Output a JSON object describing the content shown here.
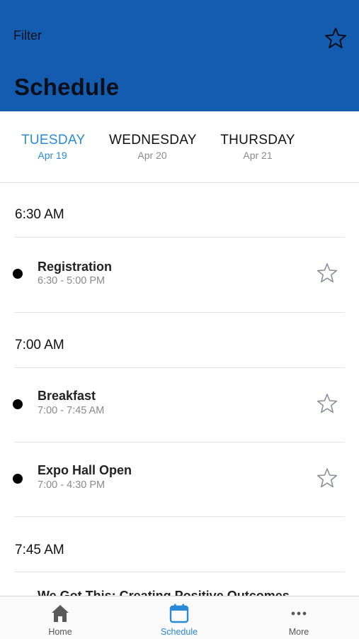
{
  "header": {
    "filter_label": "Filter",
    "title": "Schedule",
    "background_color": "#135cb0"
  },
  "days": [
    {
      "name": "TUESDAY",
      "date": "Apr 19",
      "active": true
    },
    {
      "name": "WEDNESDAY",
      "date": "Apr 20",
      "active": false
    },
    {
      "name": "THURSDAY",
      "date": "Apr 21",
      "active": false
    }
  ],
  "schedule": {
    "groups": [
      {
        "time": "6:30 AM",
        "events": [
          {
            "title": "Registration",
            "time": "6:30 - 5:00 PM"
          }
        ]
      },
      {
        "time": "7:00 AM",
        "events": [
          {
            "title": "Breakfast",
            "time": "7:00 - 7:45 AM"
          },
          {
            "title": "Expo Hall Open",
            "time": "7:00 - 4:30 PM"
          }
        ]
      },
      {
        "time": "7:45 AM",
        "events": [
          {
            "title": "We Got This: Creating Positive Outcomes",
            "time": ""
          }
        ]
      }
    ]
  },
  "tabbar": {
    "tabs": [
      {
        "label": "Home",
        "icon": "home-icon",
        "active": false
      },
      {
        "label": "Schedule",
        "icon": "calendar-icon",
        "active": true
      },
      {
        "label": "More",
        "icon": "more-icon",
        "active": false
      }
    ]
  },
  "colors": {
    "accent": "#2b8ad8",
    "header": "#135cb0"
  }
}
